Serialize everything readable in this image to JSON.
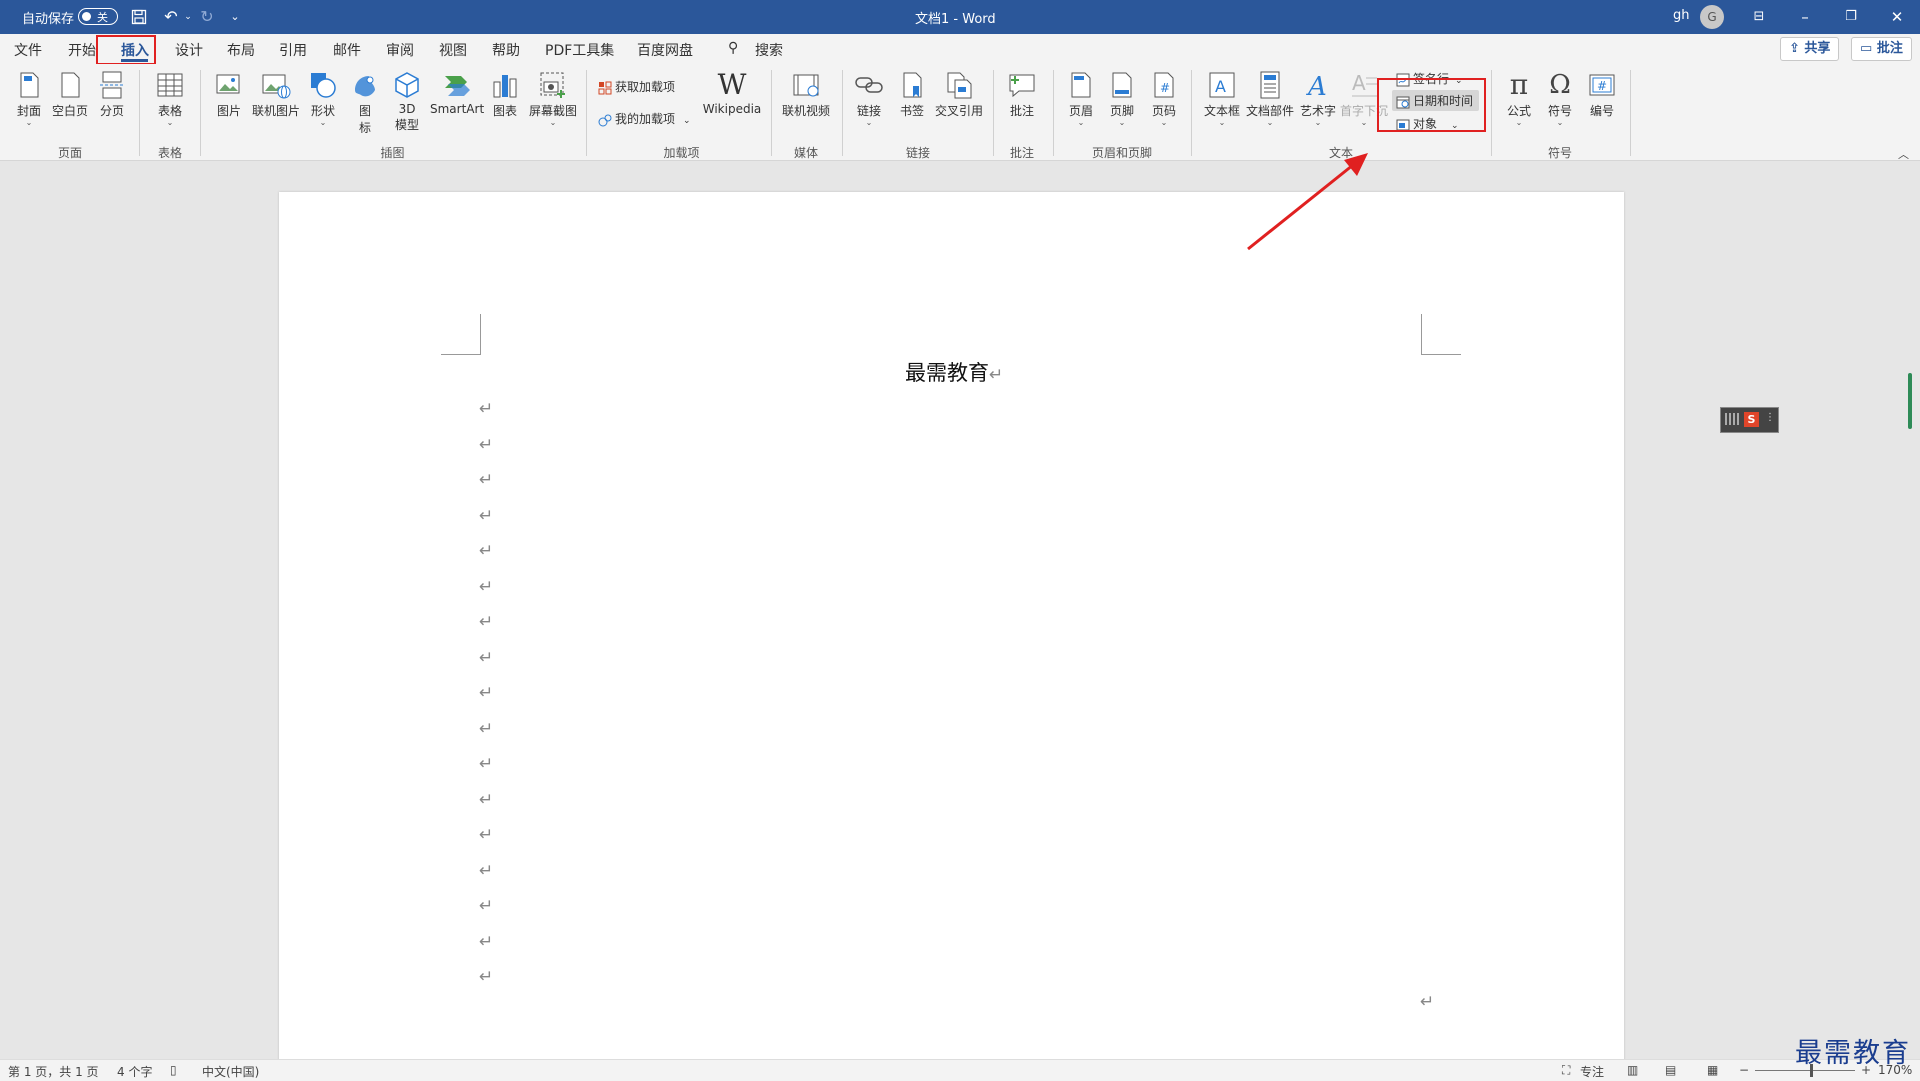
{
  "titlebar": {
    "autosave_label": "自动保存",
    "autosave_state": "关",
    "doc_title": "文档1  -  Word",
    "user_name": "gh",
    "user_initial": "G"
  },
  "menu": {
    "tabs": [
      "文件",
      "开始",
      "插入",
      "设计",
      "布局",
      "引用",
      "邮件",
      "审阅",
      "视图",
      "帮助",
      "PDF工具集",
      "百度网盘"
    ],
    "search": "搜索",
    "share": "共享",
    "comments": "批注"
  },
  "ribbon": {
    "pages": {
      "cover": "封面",
      "blank": "空白页",
      "break": "分页",
      "group": "页面"
    },
    "tables": {
      "table": "表格",
      "group": "表格"
    },
    "illustrations": {
      "picture": "图片",
      "online_picture": "联机图片",
      "shapes": "形状",
      "icons_1": "图",
      "icons_2": "标",
      "model_1": "3D",
      "model_2": "模型",
      "smartart": "SmartArt",
      "chart": "图表",
      "screenshot": "屏幕截图",
      "group": "插图"
    },
    "addins": {
      "get": "获取加载项",
      "mine": "我的加载项",
      "wikipedia": "Wikipedia",
      "group": "加载项"
    },
    "media": {
      "video": "联机视频",
      "group": "媒体"
    },
    "links": {
      "link": "链接",
      "bookmark": "书签",
      "crossref": "交叉引用",
      "group": "链接"
    },
    "comments": {
      "comment": "批注",
      "group": "批注"
    },
    "header_footer": {
      "header": "页眉",
      "footer": "页脚",
      "page_number": "页码",
      "group": "页眉和页脚"
    },
    "text": {
      "textbox": "文本框",
      "quickparts": "文档部件",
      "wordart": "艺术字",
      "dropcap": "首字下沉",
      "signature": "签名行",
      "datetime": "日期和时间",
      "object": "对象",
      "group": "文本"
    },
    "symbols": {
      "equation": "公式",
      "symbol": "符号",
      "number": "编号",
      "group": "符号"
    }
  },
  "document": {
    "title": "最需教育",
    "paragraph_mark": "↵",
    "empty_paragraphs": 17
  },
  "status": {
    "page": "第 1 页，共 1 页",
    "words": "4 个字",
    "language": "中文(中国)",
    "focus": "专注",
    "zoom": "170%"
  },
  "watermark": "最需教育",
  "colors": {
    "accent": "#2b579a",
    "highlight": "#e02020"
  }
}
